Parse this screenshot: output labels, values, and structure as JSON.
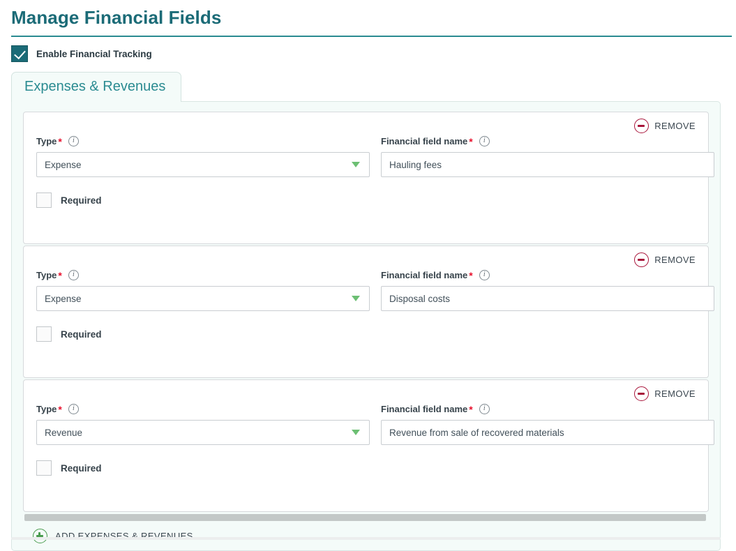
{
  "page": {
    "title": "Manage Financial Fields"
  },
  "enable_tracking": {
    "label": "Enable Financial Tracking",
    "checked": true,
    "icon": "check-icon"
  },
  "tabs": [
    {
      "label": "Expenses & Revenues",
      "active": true
    }
  ],
  "labels": {
    "type": "Type",
    "field_name": "Financial field name",
    "required": "Required",
    "required_marker": "*",
    "info_icon": "i"
  },
  "remove": {
    "label": "REMOVE",
    "icon": "minus-circle-icon",
    "color": "#a8143a"
  },
  "add": {
    "label": "ADD EXPENSES & REVENUES",
    "icon": "plus-circle-icon",
    "color": "#4a9c4f"
  },
  "type_options": [
    "Expense",
    "Revenue"
  ],
  "colors": {
    "title": "#1b6b77",
    "rule": "#2a8b91",
    "tab_text": "#2a8b91",
    "panel_bg": "#f4fbf9",
    "caret": "#6cbf73",
    "star": "#e8112d"
  },
  "rows": [
    {
      "type": "Expense",
      "field_name": "Hauling fees",
      "field_name_placeholder": "",
      "required": false
    },
    {
      "type": "Expense",
      "field_name": "Disposal costs",
      "field_name_placeholder": "",
      "required": false
    },
    {
      "type": "Revenue",
      "field_name": "Revenue from sale of recovered materials",
      "field_name_placeholder": "",
      "required": false
    }
  ]
}
